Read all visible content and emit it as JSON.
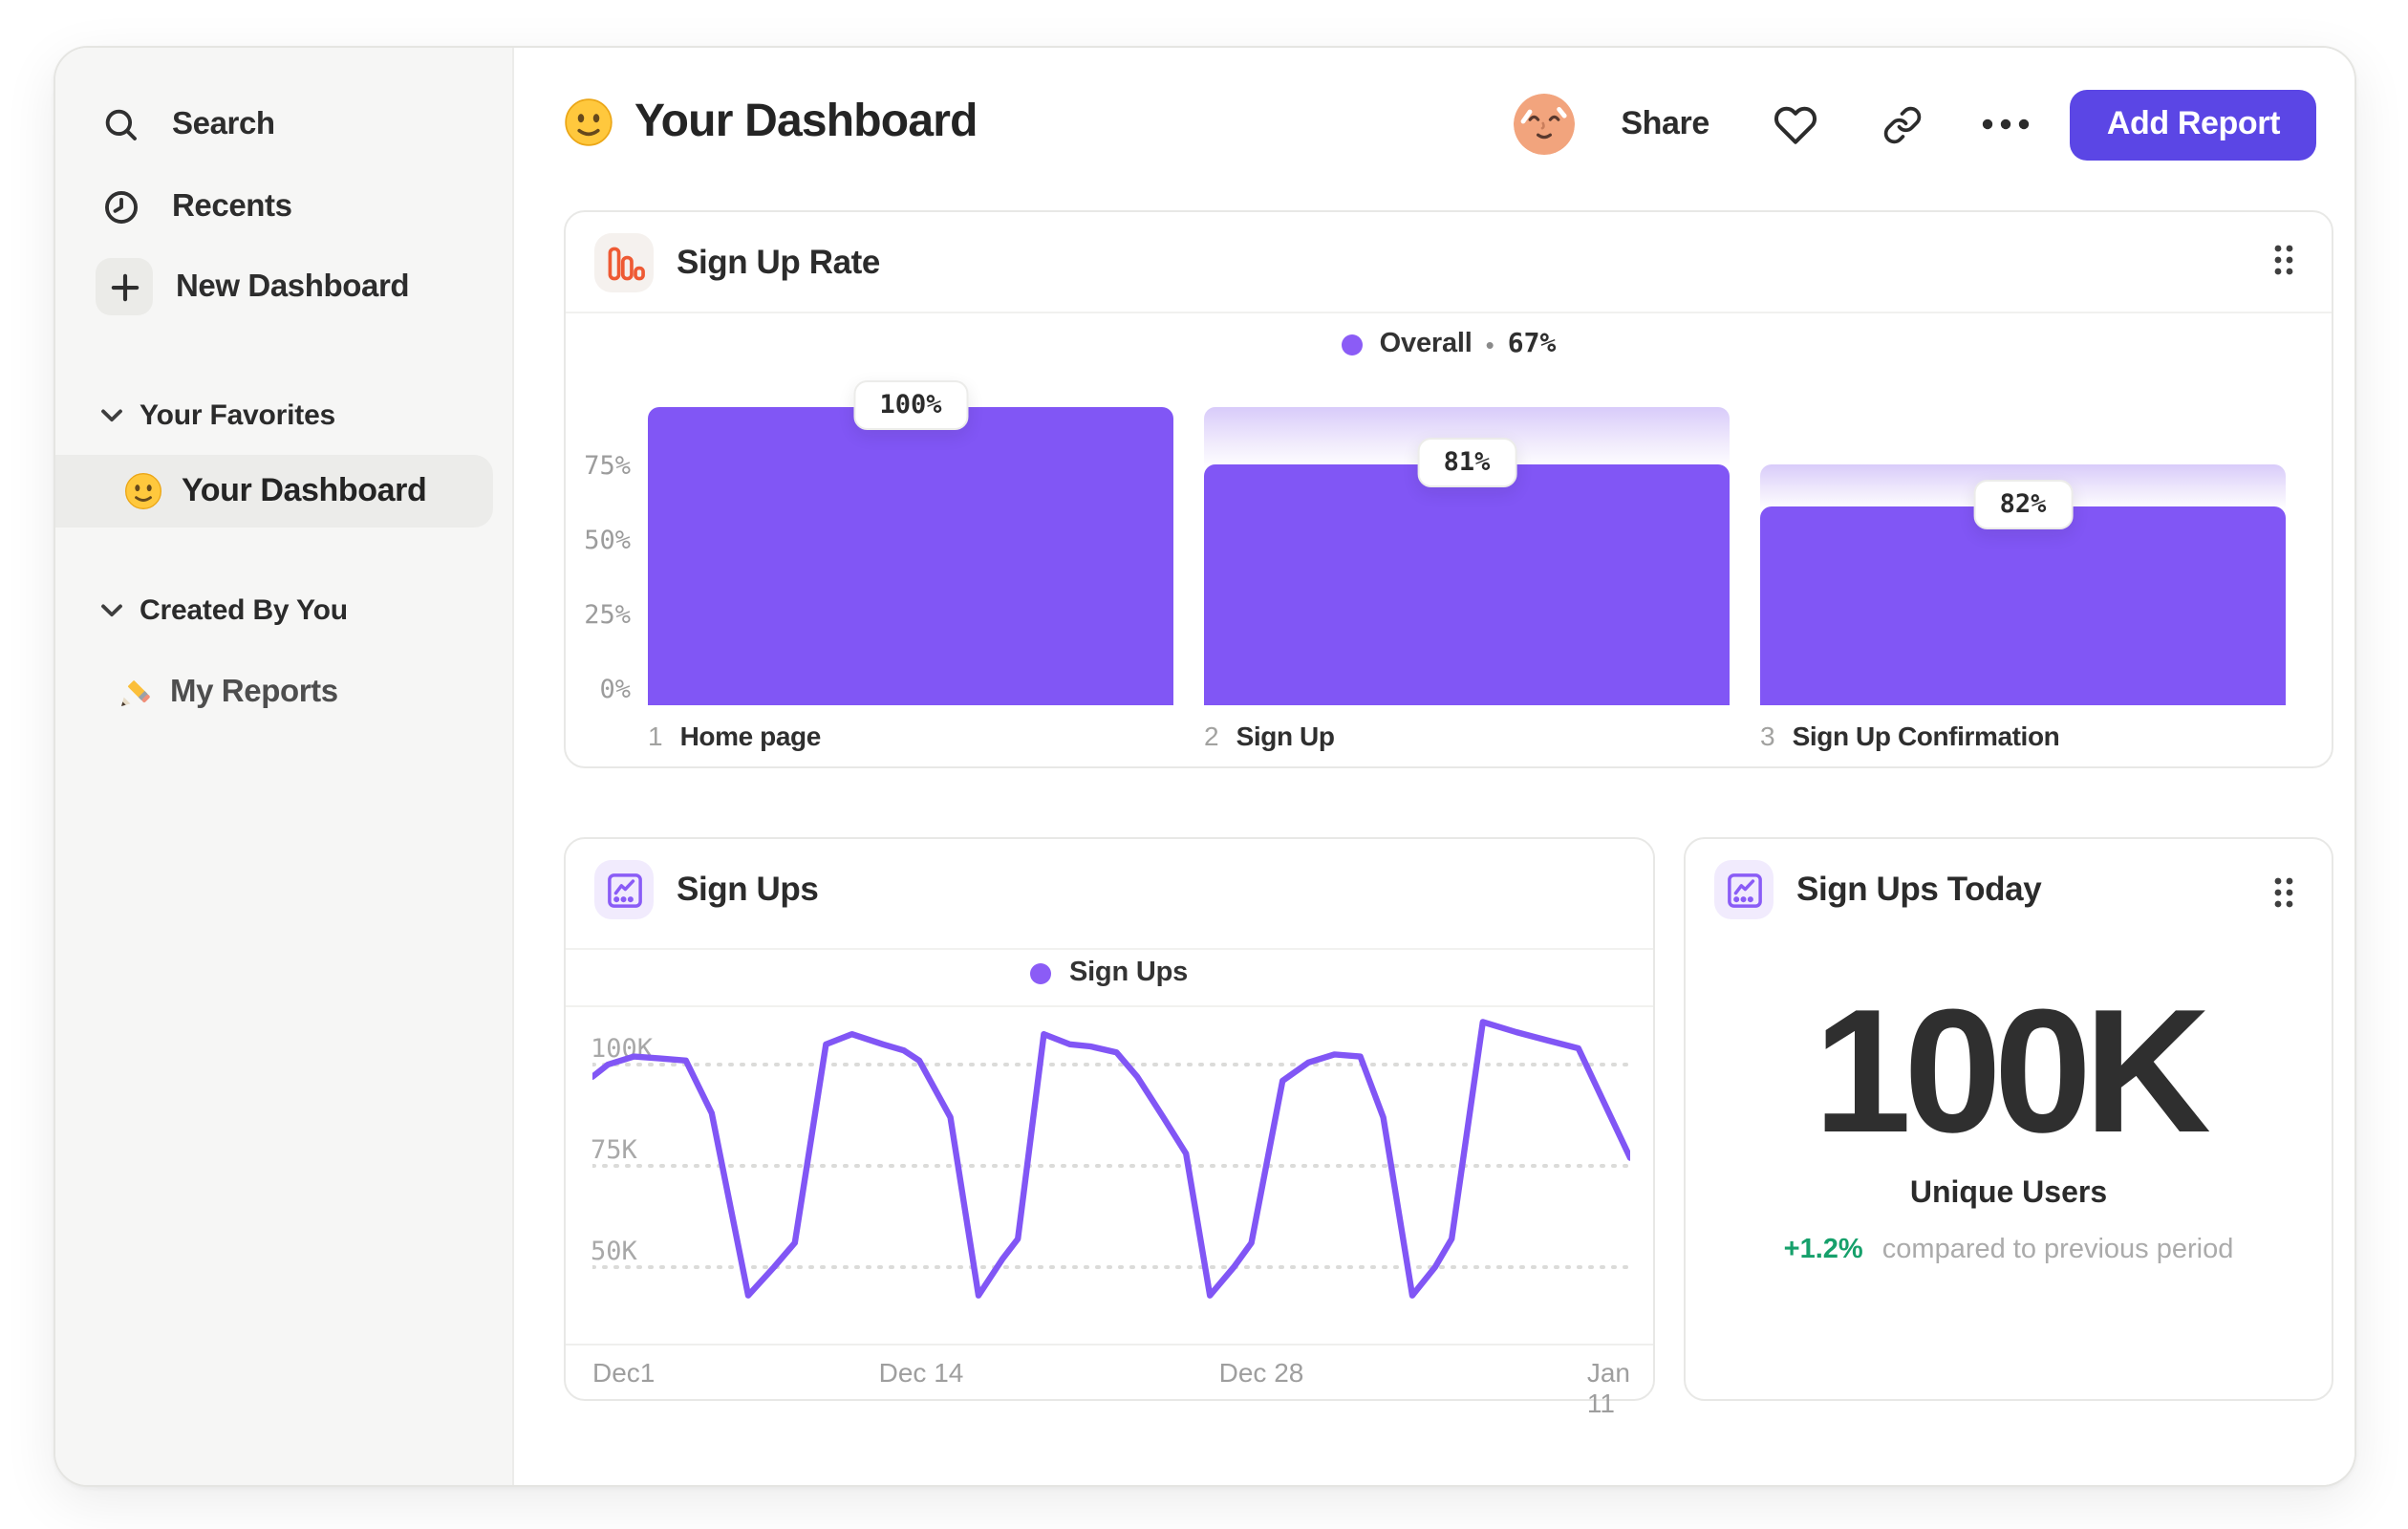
{
  "sidebar": {
    "search_label": "Search",
    "recents_label": "Recents",
    "new_dashboard_label": "New Dashboard",
    "favorites_header": "Your Favorites",
    "favorite_item_label": "Your Dashboard",
    "favorite_item_emoji": "slightly-smiling-face",
    "created_header": "Created By You",
    "reports_item_label": "My Reports",
    "reports_item_emoji": "pencil"
  },
  "header": {
    "emoji": "slightly-smiling-face",
    "title": "Your Dashboard",
    "avatar": "relieved-face-avatar",
    "share_label": "Share",
    "add_report_label": "Add Report"
  },
  "cards": {
    "sign_up_rate": {
      "title": "Sign Up Rate",
      "icon": "funnel-bars-icon",
      "legend_label": "Overall",
      "legend_sep": "•",
      "legend_value": "67%",
      "y_ticks": [
        "75%",
        "50%",
        "25%",
        "0%"
      ],
      "bars": [
        {
          "num": "1",
          "label": "Home page",
          "value": "100%"
        },
        {
          "num": "2",
          "label": "Sign Up",
          "value": "81%"
        },
        {
          "num": "3",
          "label": "Sign Up Confirmation",
          "value": "82%"
        }
      ]
    },
    "sign_ups": {
      "title": "Sign Ups",
      "icon": "line-chart-icon",
      "legend_label": "Sign Ups",
      "y_ticks": [
        "100K",
        "75K",
        "50K"
      ],
      "x_ticks": [
        "Dec1",
        "Dec 14",
        "Dec 28",
        "Jan 11"
      ]
    },
    "sign_ups_today": {
      "title": "Sign Ups Today",
      "icon": "line-chart-icon",
      "value": "100K",
      "subtitle": "Unique Users",
      "change": "+1.2%",
      "change_note": "compared to previous period"
    }
  },
  "colors": {
    "accent_purple": "#8156F5",
    "legend_dot_purple": "#8B5CF6",
    "button_purple": "#5B46E5",
    "funnel_icon_orange": "#EE5A34",
    "positive_green": "#16A06B",
    "sidebar_bg": "#F6F6F5"
  },
  "chart_data": [
    {
      "type": "bar",
      "title": "Sign Up Rate",
      "legend": "Overall • 67%",
      "overall_pct": 67,
      "categories": [
        "Home page",
        "Sign Up",
        "Sign Up Confirmation"
      ],
      "step_conversion_pct": [
        100,
        81,
        82
      ],
      "cumulative_pct": [
        100,
        81,
        66.4
      ],
      "value_labels": [
        "100%",
        "81%",
        "82%"
      ],
      "y_ticks_pct": [
        0,
        25,
        50,
        75
      ],
      "ylim": [
        0,
        100
      ],
      "bar_color": "#8156F5",
      "backdrop": "previous-step gradient light purple to white",
      "grid": false,
      "legend_position": "top-center"
    },
    {
      "type": "line",
      "title": "Sign Ups",
      "legend": "Sign Ups",
      "x_ticks": [
        "Dec1",
        "Dec 14",
        "Dec 28",
        "Jan 11"
      ],
      "x_tick_fractions": [
        0,
        0.317,
        0.645,
        1
      ],
      "y_ticks": [
        "50K",
        "75K",
        "100K"
      ],
      "y_gridlines_k": [
        100,
        75,
        50
      ],
      "unit": "K signups",
      "ylim_k": [
        40,
        115
      ],
      "line_color": "#8156F5",
      "grid": "dotted horizontal",
      "legend_position": "top-center",
      "series": [
        {
          "name": "Sign Ups",
          "points": [
            [
              0.0,
              97
            ],
            [
              0.015,
              100
            ],
            [
              0.04,
              102
            ],
            [
              0.065,
              101.5
            ],
            [
              0.09,
              101
            ],
            [
              0.115,
              88
            ],
            [
              0.15,
              43
            ],
            [
              0.175,
              50
            ],
            [
              0.195,
              56
            ],
            [
              0.225,
              105
            ],
            [
              0.25,
              107.5
            ],
            [
              0.28,
              105
            ],
            [
              0.3,
              103.5
            ],
            [
              0.315,
              101
            ],
            [
              0.345,
              87
            ],
            [
              0.372,
              43
            ],
            [
              0.395,
              52
            ],
            [
              0.41,
              57
            ],
            [
              0.435,
              107.5
            ],
            [
              0.46,
              105
            ],
            [
              0.48,
              104.5
            ],
            [
              0.505,
              103
            ],
            [
              0.525,
              97
            ],
            [
              0.55,
              87
            ],
            [
              0.572,
              78
            ],
            [
              0.595,
              43
            ],
            [
              0.618,
              50
            ],
            [
              0.635,
              56
            ],
            [
              0.665,
              96
            ],
            [
              0.69,
              100.5
            ],
            [
              0.715,
              102.5
            ],
            [
              0.74,
              102
            ],
            [
              0.762,
              87
            ],
            [
              0.79,
              43
            ],
            [
              0.812,
              50
            ],
            [
              0.828,
              57
            ],
            [
              0.858,
              110.5
            ],
            [
              0.89,
              108
            ],
            [
              0.92,
              106
            ],
            [
              0.95,
              104
            ],
            [
              1.0,
              77
            ]
          ]
        }
      ]
    },
    {
      "type": "table",
      "title": "Sign Ups Today",
      "metric_value": "100K",
      "metric_label": "Unique Users",
      "change_pct": "+1.2%",
      "change_note": "compared to previous period"
    }
  ]
}
